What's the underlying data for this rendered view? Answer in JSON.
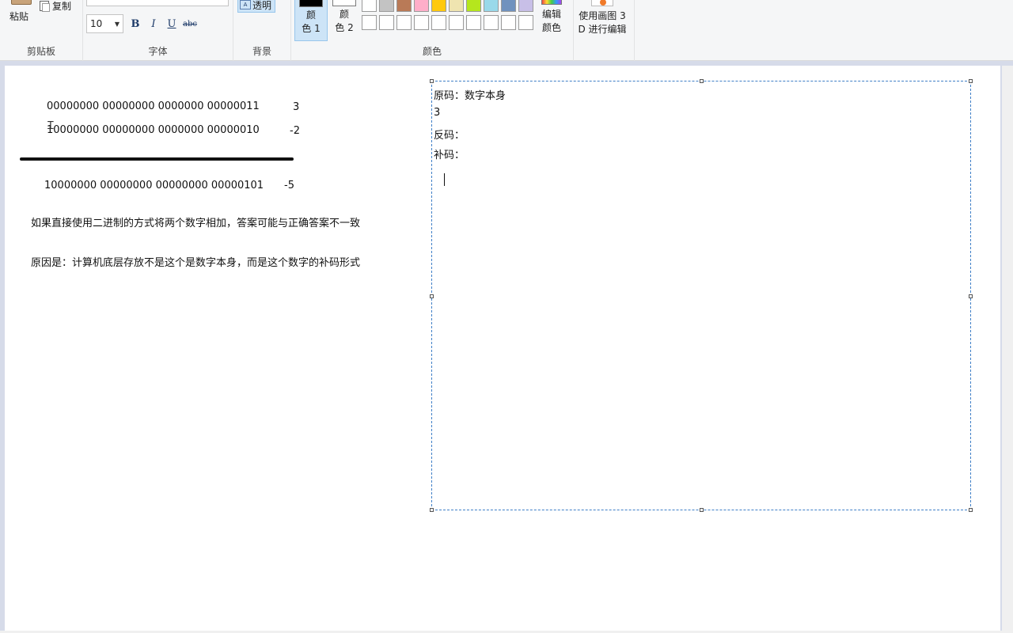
{
  "ribbon": {
    "clipboard": {
      "paste_label": "粘贴",
      "copy_label": "复制",
      "group_label": "剪贴板"
    },
    "font": {
      "size_value": "10",
      "bold": "B",
      "italic": "I",
      "underline": "U",
      "strike": "abc",
      "group_label": "字体"
    },
    "background": {
      "transparent_label": "透明",
      "group_label": "背景"
    },
    "colors": {
      "color1_label": "颜\n色 1",
      "color2_label": "颜\n色 2",
      "edit_label": "编辑\n颜色",
      "group_label": "颜色",
      "color1": "#000000",
      "color2": "#ffffff",
      "palette_row1": [
        "#ffffff",
        "#c3c3c3",
        "#b97a57",
        "#ffaec9",
        "#ffc90e",
        "#efe4b0",
        "#b5e61d",
        "#99d9ea",
        "#7092be",
        "#c8bfe7"
      ],
      "palette_row2": [
        "#ffffff",
        "#ffffff",
        "#ffffff",
        "#ffffff",
        "#ffffff",
        "#ffffff",
        "#ffffff",
        "#ffffff",
        "#ffffff",
        "#ffffff"
      ]
    },
    "paint3d": {
      "label": "使用画图 3\nD 进行编辑"
    }
  },
  "canvas": {
    "line1_binary": "00000000 00000000 0000000 00000011",
    "line1_value": "3",
    "line2_binary": "10000000 00000000 0000000 00000010",
    "line2_value": "-2",
    "line3_binary": "10000000 00000000 00000000 00000101",
    "line3_value": "-5",
    "note1": "如果直接使用二进制的方式将两个数字相加，答案可能与正确答案不一致",
    "note2": "原因是：计算机底层存放不是这个是数字本身，而是这个数字的补码形式",
    "textbox": {
      "line1": "原码：数字本身",
      "line2": "3",
      "line3": "反码：",
      "line4": "补码："
    }
  }
}
